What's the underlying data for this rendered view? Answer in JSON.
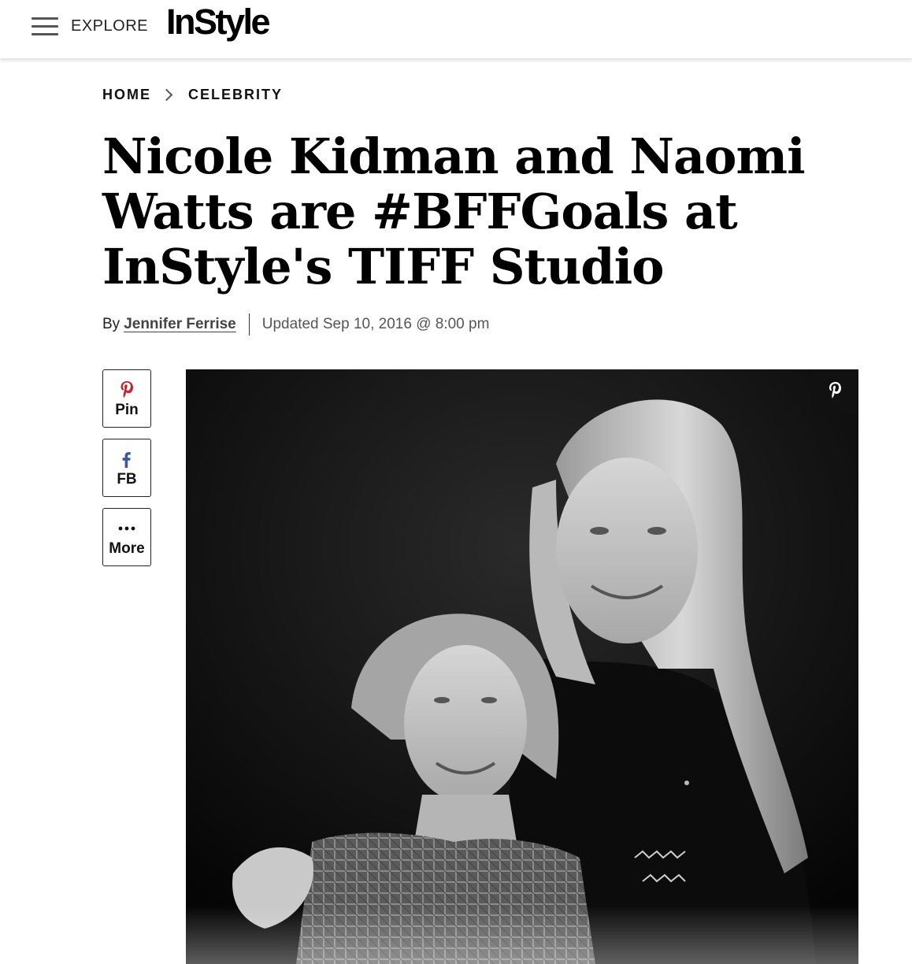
{
  "header": {
    "menu_icon": "hamburger-icon",
    "explore_label": "EXPLORE",
    "logo_text": "InStyle"
  },
  "breadcrumb": {
    "items": [
      {
        "label": "HOME"
      },
      {
        "label": "CELEBRITY"
      }
    ],
    "separator_icon": "chevron-right-icon"
  },
  "article": {
    "title": "Nicole Kidman and Naomi Watts are #BFFGoals at InStyle's TIFF Studio",
    "byline_prefix": "By",
    "author": "Jennifer Ferrise",
    "updated": "Updated Sep 10, 2016 @ 8:00 pm"
  },
  "share": {
    "pin_label": "Pin",
    "pin_icon": "pinterest-icon",
    "pin_color": "#c8232c",
    "fb_label": "FB",
    "fb_icon": "facebook-icon",
    "fb_color": "#3b5998",
    "more_label": "More",
    "more_icon": "more-dots-icon"
  },
  "hero_image": {
    "style": "black-and-white portrait",
    "pin_overlay_icon": "pinterest-icon"
  }
}
